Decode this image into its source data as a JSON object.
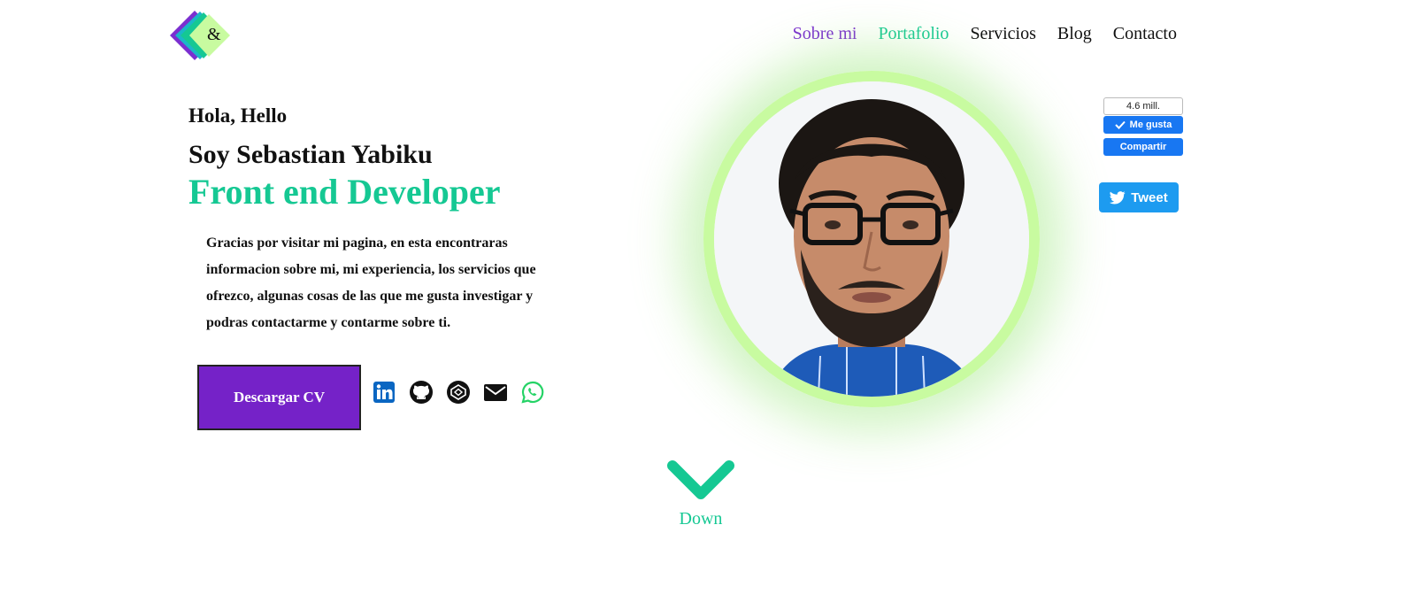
{
  "logo": {
    "text": "&",
    "colors": [
      "#7b2fd0",
      "#1bb6c9",
      "#15c893",
      "#c8fba0"
    ]
  },
  "nav": {
    "items": [
      {
        "label": "Sobre mi",
        "color": "#7b2fd0"
      },
      {
        "label": "Portafolio",
        "color": "#15c893"
      },
      {
        "label": "Servicios"
      },
      {
        "label": "Blog"
      },
      {
        "label": "Contacto"
      }
    ]
  },
  "hero": {
    "greeting": "Hola, Hello",
    "name": "Soy Sebastian Yabiku",
    "role": "Front end Developer",
    "intro": "Gracias por visitar mi pagina, en esta encontraras informacion sobre mi, mi experiencia, los servicios que ofrezco, algunas cosas de las que me gusta investigar y podras contactarme y contarme sobre ti.",
    "cv_button": "Descargar CV",
    "accent_color": "#15c893",
    "button_color": "#7522c8"
  },
  "social": [
    "linkedin-icon",
    "github-icon",
    "codepen-icon",
    "email-icon",
    "whatsapp-icon"
  ],
  "facebook": {
    "count": "4.6 mill.",
    "like_label": "Me gusta",
    "share_label": "Compartir"
  },
  "twitter": {
    "label": "Tweet"
  },
  "down": {
    "label": "Down"
  }
}
